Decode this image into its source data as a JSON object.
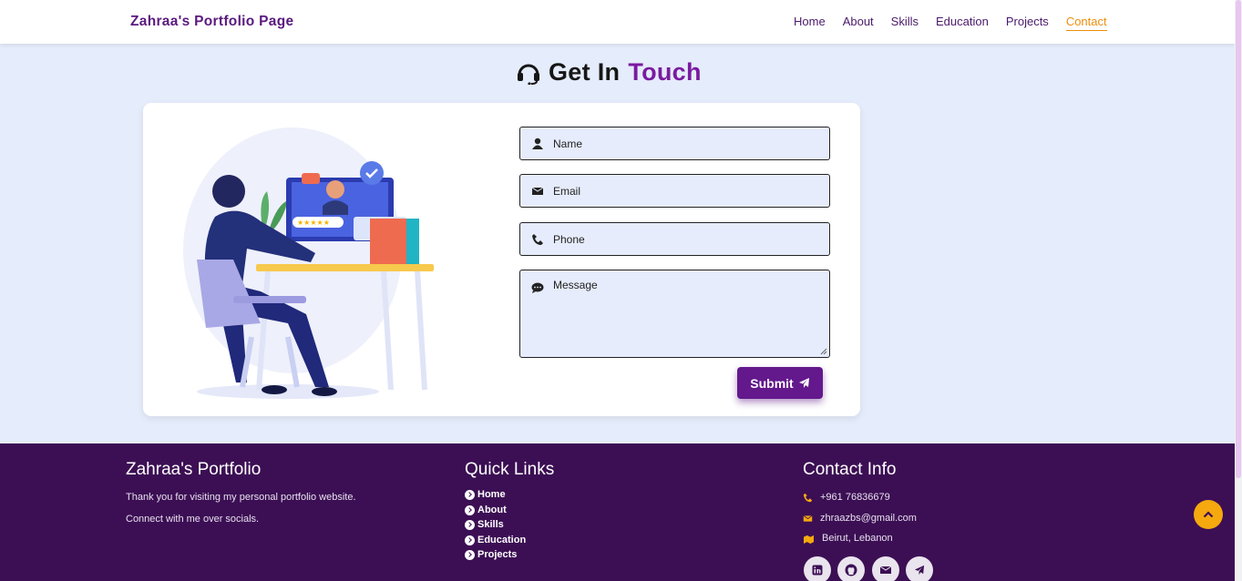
{
  "header": {
    "brand": "Zahraa's Portfolio Page",
    "nav": [
      "Home",
      "About",
      "Skills",
      "Education",
      "Projects",
      "Contact"
    ],
    "active": "Contact"
  },
  "section": {
    "title_main": "Get In",
    "title_accent": "Touch"
  },
  "form": {
    "name_placeholder": "Name",
    "email_placeholder": "Email",
    "phone_placeholder": "Phone",
    "message_placeholder": "Message",
    "submit_label": "Submit"
  },
  "footer": {
    "about_title": "Zahraa's Portfolio",
    "about_text_1": "Thank you for visiting my personal portfolio website.",
    "about_text_2": "Connect with me over socials.",
    "links_title": "Quick Links",
    "links": [
      "Home",
      "About",
      "Skills",
      "Education",
      "Projects"
    ],
    "contact_title": "Contact Info",
    "phone": "+961 76836679",
    "email": "zhraazbs@gmail.com",
    "location": "Beirut, Lebanon"
  },
  "colors": {
    "accent": "#7a1ba0",
    "active_nav": "#ee8f0c",
    "footer_bg": "#3c0f54",
    "background": "#e5ecfb"
  }
}
